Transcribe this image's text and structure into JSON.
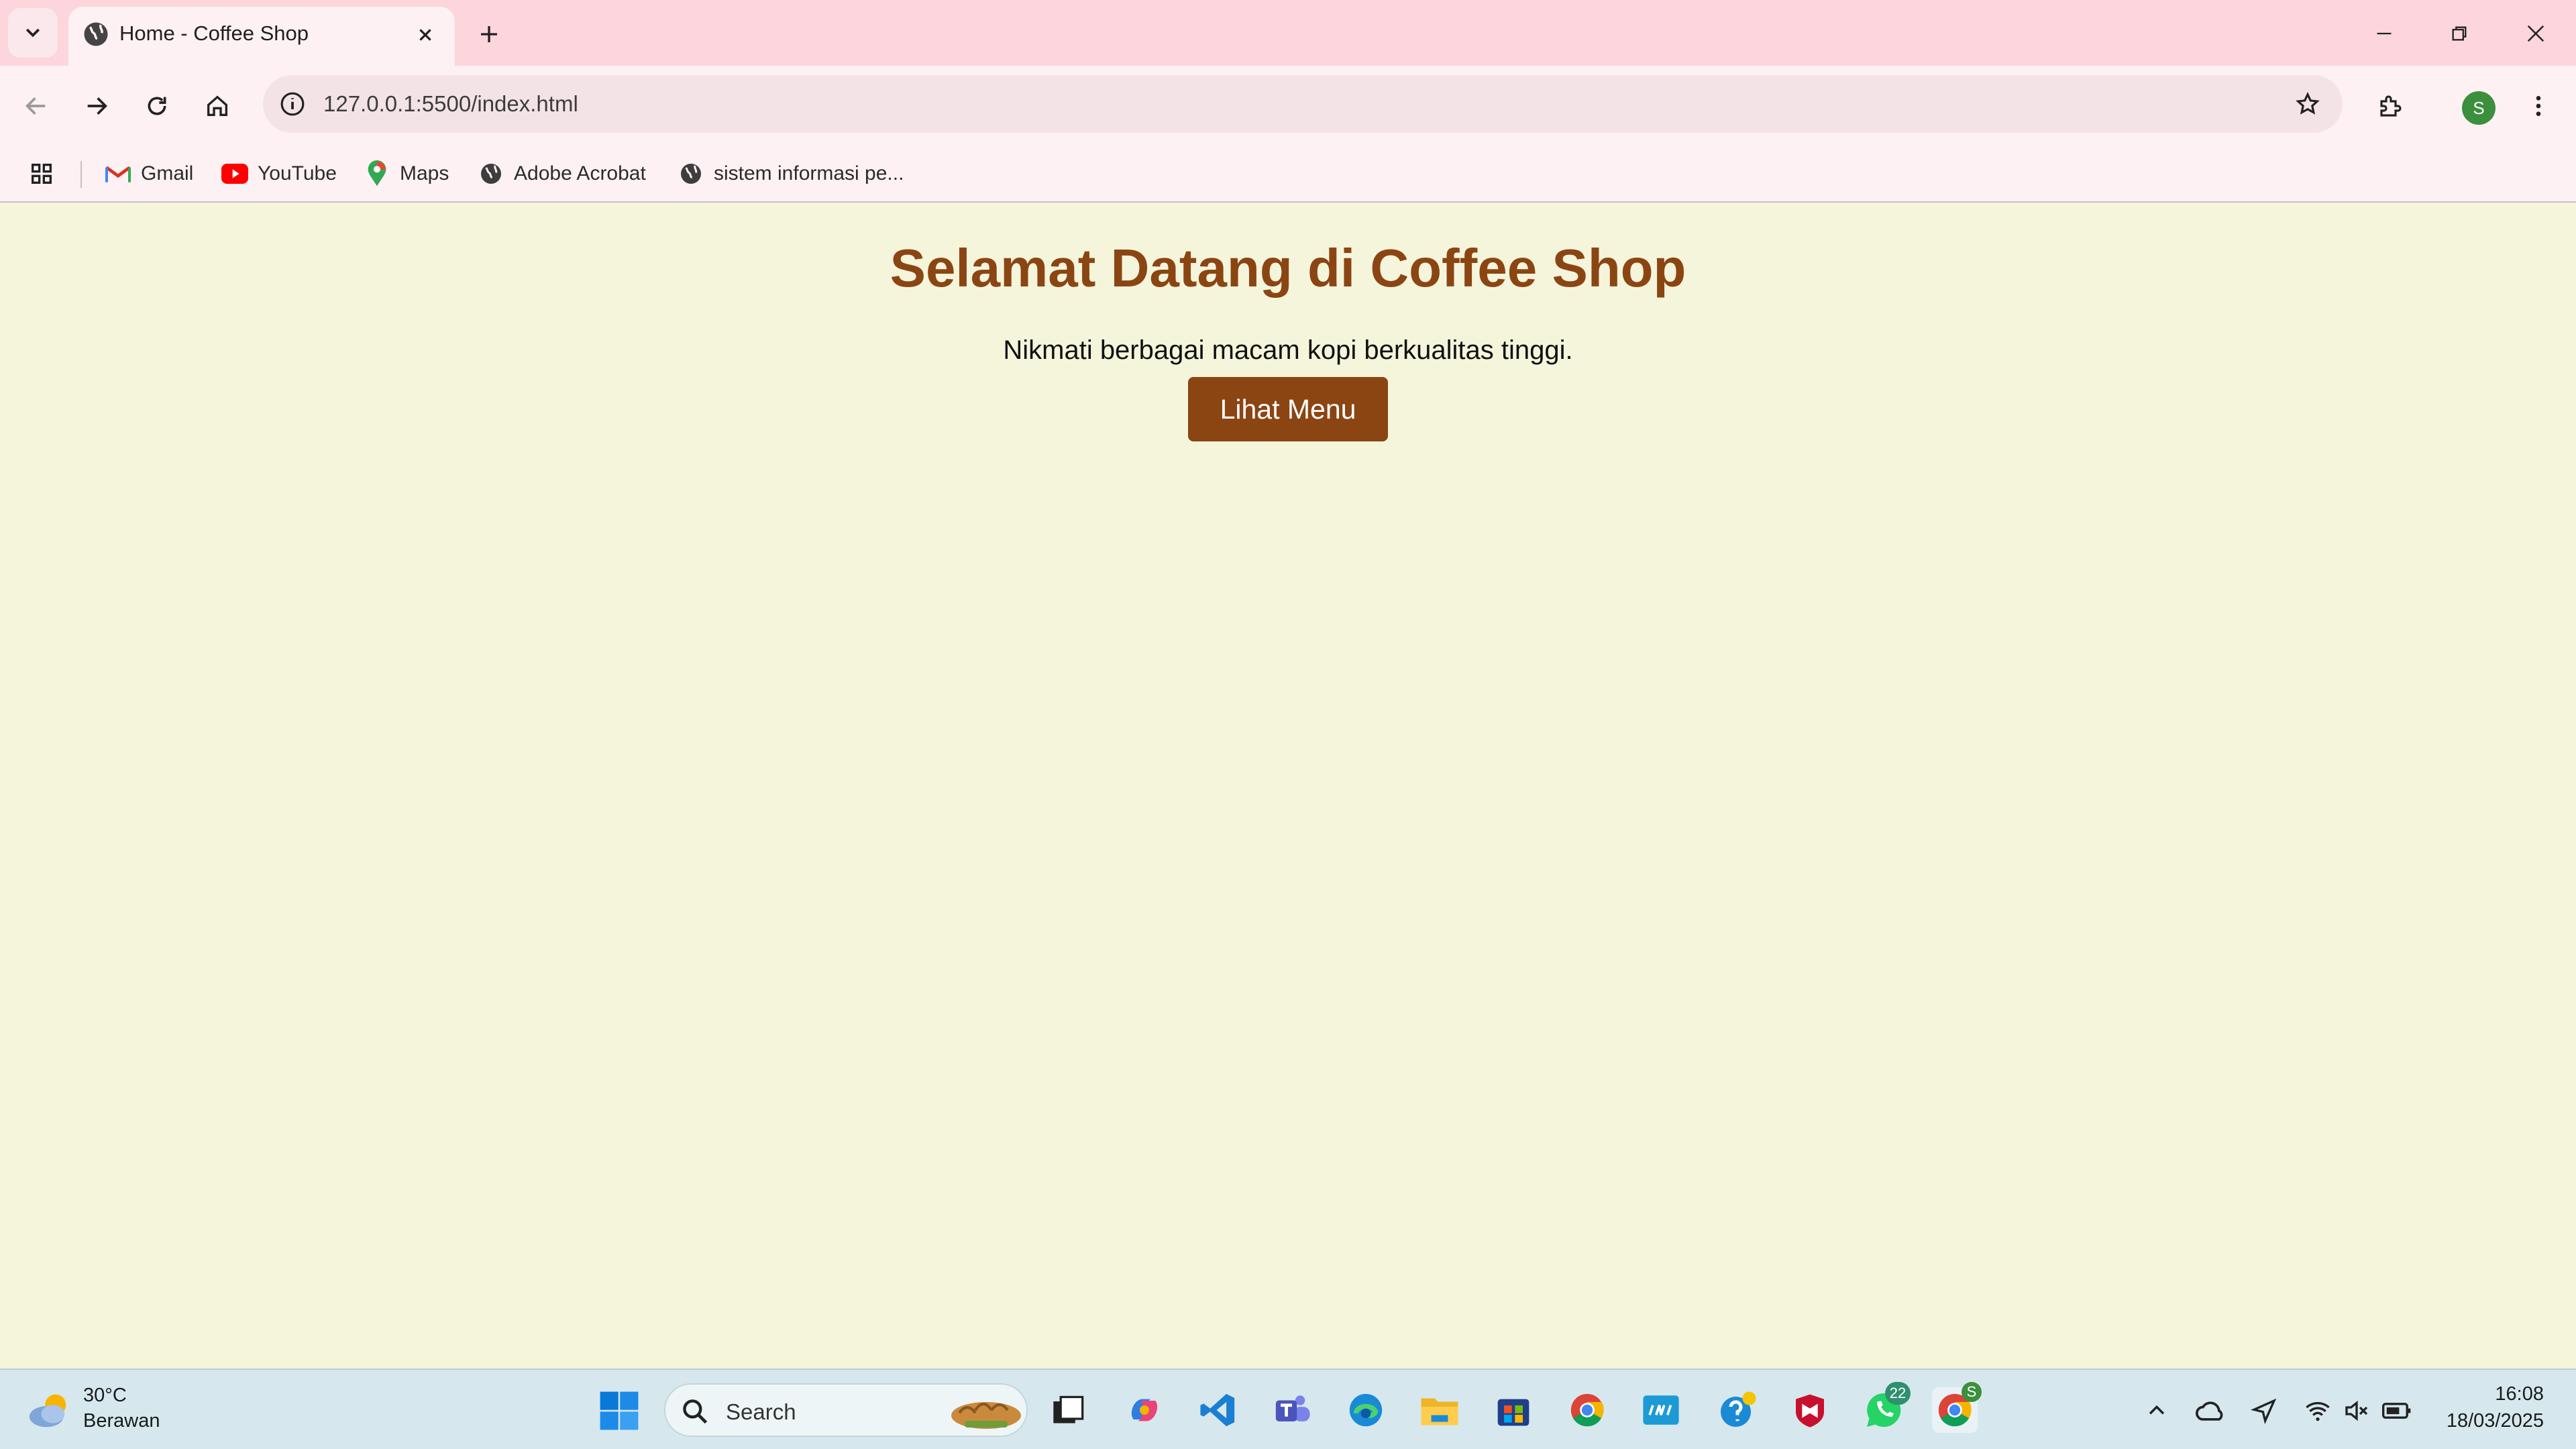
{
  "browser": {
    "tab": {
      "title": "Home - Coffee Shop"
    },
    "address_bar": {
      "url": "127.0.0.1:5500/index.html"
    },
    "profile_initial": "S",
    "bookmarks": [
      {
        "label": "Gmail",
        "icon": "gmail-icon"
      },
      {
        "label": "YouTube",
        "icon": "youtube-icon"
      },
      {
        "label": "Maps",
        "icon": "maps-icon"
      },
      {
        "label": "Adobe Acrobat",
        "icon": "globe-icon"
      },
      {
        "label": "sistem informasi pe...",
        "icon": "globe-icon"
      }
    ]
  },
  "page": {
    "heading": "Selamat Datang di Coffee Shop",
    "subtitle": "Nikmati berbagai macam kopi berkualitas tinggi.",
    "menu_button": "Lihat Menu",
    "colors": {
      "background": "#f5f5dc",
      "accent": "#8b4513"
    }
  },
  "taskbar": {
    "weather": {
      "temp": "30°C",
      "desc": "Berawan"
    },
    "search_placeholder": "Search",
    "whatsapp_badge": "22",
    "chrome_badge": "S",
    "time": "16:08",
    "date": "18/03/2025"
  }
}
